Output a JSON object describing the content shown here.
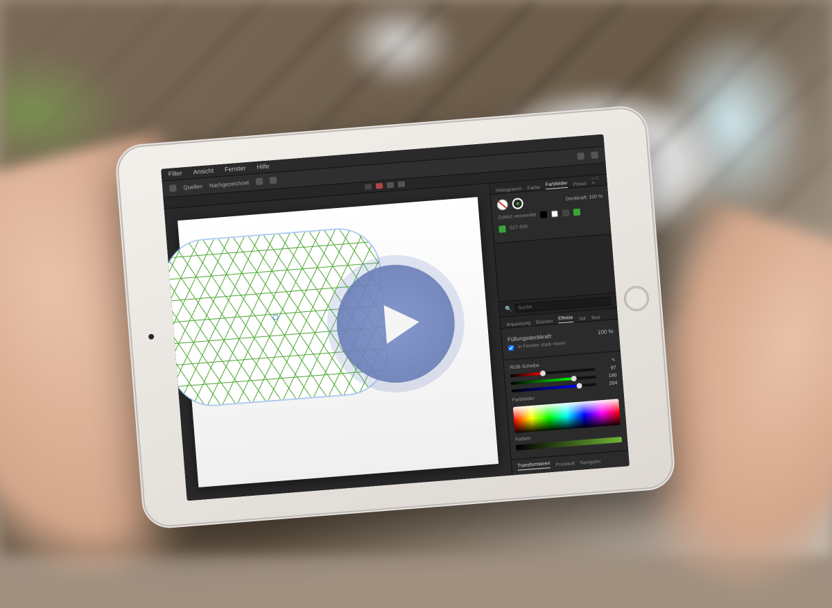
{
  "menubar": {
    "items": [
      "Filter",
      "Ansicht",
      "Fenster",
      "Hilfe"
    ]
  },
  "toolbar": {
    "left1": "Quellen",
    "left2": "Nachgezeichnet"
  },
  "panels": {
    "swatch_tabs": {
      "t1": "Histogramm",
      "t2": "Farbe",
      "t3": "Farbfelder",
      "t4": "Pinsel"
    },
    "opacity_label": "Deckkraft:",
    "opacity_value": "100 %",
    "recent_label": "Zuletzt verwendet",
    "swatch_code": "017-639",
    "search_placeholder": "Suche",
    "stroke_tabs": {
      "t1": "Anpassung",
      "t2": "Ebenen",
      "t3": "Effekte",
      "t4": "Stil",
      "t5": "Text"
    },
    "stroke_field_label": "Füllungsdeckkraft:",
    "stroke_field_value": "100 %",
    "color_checkbox": "In Fenster stark mixen",
    "color_mode": "RGB-Scheibe",
    "rgb": {
      "r": 97,
      "g": 190,
      "b": 204
    },
    "swatches_label": "Farbfelder",
    "opacity_section": "Farben",
    "transform_label": "Transformieren",
    "tf1": "Protokoll",
    "tf2": "Navigator"
  }
}
